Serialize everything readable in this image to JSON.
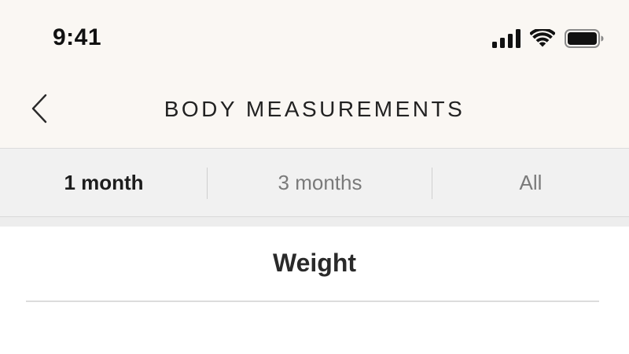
{
  "status_bar": {
    "time": "9:41",
    "icons": [
      "cellular-signal-icon",
      "wifi-icon",
      "battery-icon"
    ]
  },
  "nav": {
    "back_icon": "chevron-left-icon",
    "title": "BODY MEASUREMENTS"
  },
  "range_selector": {
    "options": [
      {
        "label": "1 month",
        "selected": true
      },
      {
        "label": "3 months",
        "selected": false
      },
      {
        "label": "All",
        "selected": false
      }
    ]
  },
  "section": {
    "title": "Weight"
  },
  "colors": {
    "header_background": "#faf7f3",
    "segment_background": "#f1f1f1",
    "selected_text": "#1d1d1d",
    "unselected_text": "#7a7a7a",
    "divider": "#dcdcdc"
  }
}
